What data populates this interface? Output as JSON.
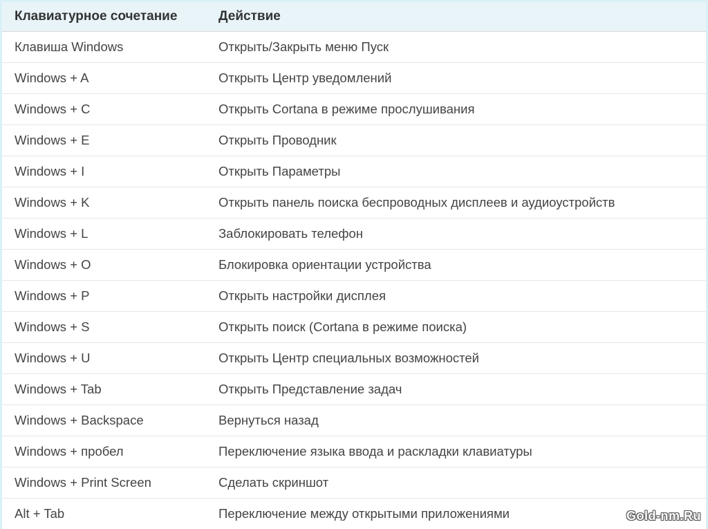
{
  "headers": {
    "shortcut": "Клавиатурное сочетание",
    "action": "Действие"
  },
  "rows": [
    {
      "shortcut": "Клавиша Windows",
      "action": "Открыть/Закрыть меню Пуск"
    },
    {
      "shortcut": "Windows + A",
      "action": "Открыть Центр уведомлений"
    },
    {
      "shortcut": "Windows + C",
      "action": "Открыть Cortana в режиме прослушивания"
    },
    {
      "shortcut": "Windows + E",
      "action": "Открыть Проводник"
    },
    {
      "shortcut": "Windows + I",
      "action": "Открыть Параметры"
    },
    {
      "shortcut": "Windows + K",
      "action": "Открыть панель поиска беспроводных дисплеев и аудиоустройств"
    },
    {
      "shortcut": "Windows + L",
      "action": "Заблокировать телефон"
    },
    {
      "shortcut": "Windows + O",
      "action": "Блокировка ориентации устройства"
    },
    {
      "shortcut": "Windows + P",
      "action": "Открыть настройки дисплея"
    },
    {
      "shortcut": "Windows + S",
      "action": "Открыть поиск (Cortana в режиме поиска)"
    },
    {
      "shortcut": "Windows + U",
      "action": "Открыть Центр специальных возможностей"
    },
    {
      "shortcut": "Windows + Tab",
      "action": "Открыть Представление задач"
    },
    {
      "shortcut": "Windows + Backspace",
      "action": "Вернуться назад"
    },
    {
      "shortcut": "Windows + пробел",
      "action": "Переключение языка ввода и раскладки клавиатуры"
    },
    {
      "shortcut": "Windows + Print Screen",
      "action": "Сделать скриншот"
    },
    {
      "shortcut": "Alt + Tab",
      "action": "Переключение между открытыми приложениями"
    }
  ],
  "watermark": "Gold-nm.Ru"
}
